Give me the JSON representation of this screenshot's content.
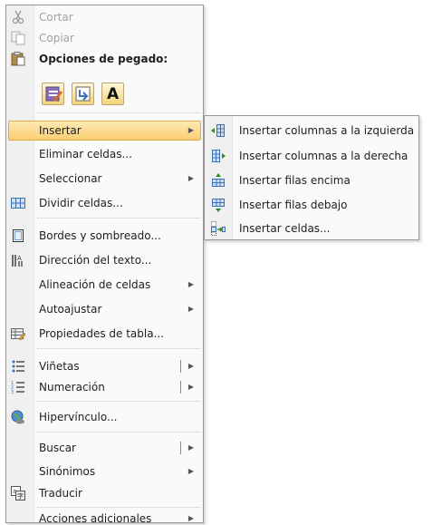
{
  "menu": {
    "cut": "Cortar",
    "copy": "Copiar",
    "paste_options_header": "Opciones de pegado:",
    "paste_btn3": "A",
    "insert": "Insertar",
    "delete_cells": "Eliminar celdas...",
    "select": "Seleccionar",
    "split_cells": "Dividir celdas...",
    "borders": "Bordes y sombreado...",
    "text_direction": "Dirección del texto...",
    "cell_alignment": "Alineación de celdas",
    "autofit": "Autoajustar",
    "table_properties": "Propiedades de tabla...",
    "bullets": "Viñetas",
    "numbering": "Numeración",
    "hyperlink": "Hipervínculo...",
    "search": "Buscar",
    "synonyms": "Sinónimos",
    "translate": "Traducir",
    "additional_actions": "Acciones adicionales"
  },
  "submenu": {
    "insert_columns_left": "Insertar columnas a la izquierda",
    "insert_columns_right": "Insertar columnas a la derecha",
    "insert_rows_above": "Insertar filas encima",
    "insert_rows_below": "Insertar filas debajo",
    "insert_cells": "Insertar celdas..."
  },
  "colors": {
    "highlight": "#fbcf72",
    "icon_blue": "#3b6fb6"
  }
}
